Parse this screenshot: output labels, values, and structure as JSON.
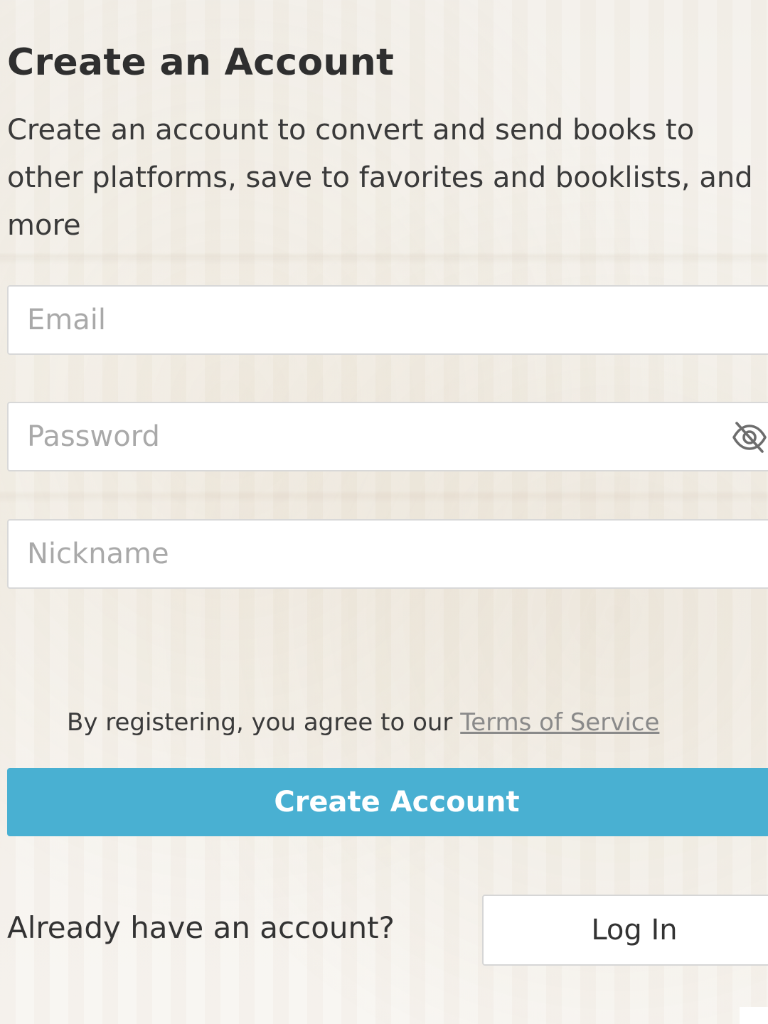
{
  "header": {
    "title": "Create an Account",
    "description": "Create an account to convert and send books to other platforms, save to favorites and booklists, and more"
  },
  "form": {
    "email_placeholder": "Email",
    "password_placeholder": "Password",
    "nickname_placeholder": "Nickname",
    "password_toggle_icon": "eye-off-icon"
  },
  "terms": {
    "prefix": "By registering, you agree to our ",
    "link_label": "Terms of Service"
  },
  "actions": {
    "create_label": "Create Account",
    "already_text": "Already have an account?",
    "login_label": "Log In"
  },
  "colors": {
    "accent": "#49b0d2",
    "text": "#333333",
    "placeholder": "#a9a9a9"
  }
}
